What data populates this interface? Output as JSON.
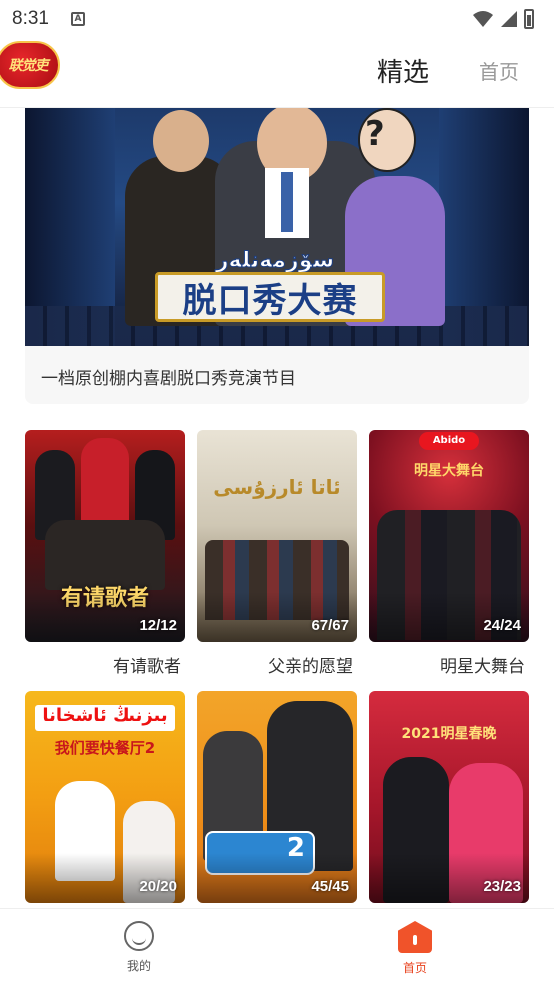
{
  "status_bar": {
    "time": "8:31",
    "notification_glyph": "A"
  },
  "header": {
    "logo_text": "联觉吏",
    "tab_selected": "精选",
    "tab_home": "首页"
  },
  "feature": {
    "banner_title": "脱口秀大赛",
    "banner_uyghur": "سۆزمەنلەر بەيگىسى",
    "description": "一档原创棚内喜剧脱口秀竞演节目"
  },
  "programs": [
    {
      "title": "有请歌者",
      "count": "12/12",
      "overlay": "有请歌者"
    },
    {
      "title": "父亲的愿望",
      "count": "67/67",
      "overlay": "ئاتا ئارزۇسى"
    },
    {
      "title": "明星大舞台",
      "count": "24/24",
      "overlay": "明星大舞台"
    },
    {
      "title": "",
      "count": "20/20",
      "overlay": "我们要快餐厅2"
    },
    {
      "title": "",
      "count": "45/45",
      "overlay": "2"
    },
    {
      "title": "",
      "count": "23/23",
      "overlay": "2021明星春晚"
    }
  ],
  "bottom_nav": {
    "mine_label": "我的",
    "home_label": "首页"
  },
  "colors": {
    "accent": "#e8431f",
    "logo_red": "#d81e24",
    "logo_gold": "#f7c54a"
  }
}
